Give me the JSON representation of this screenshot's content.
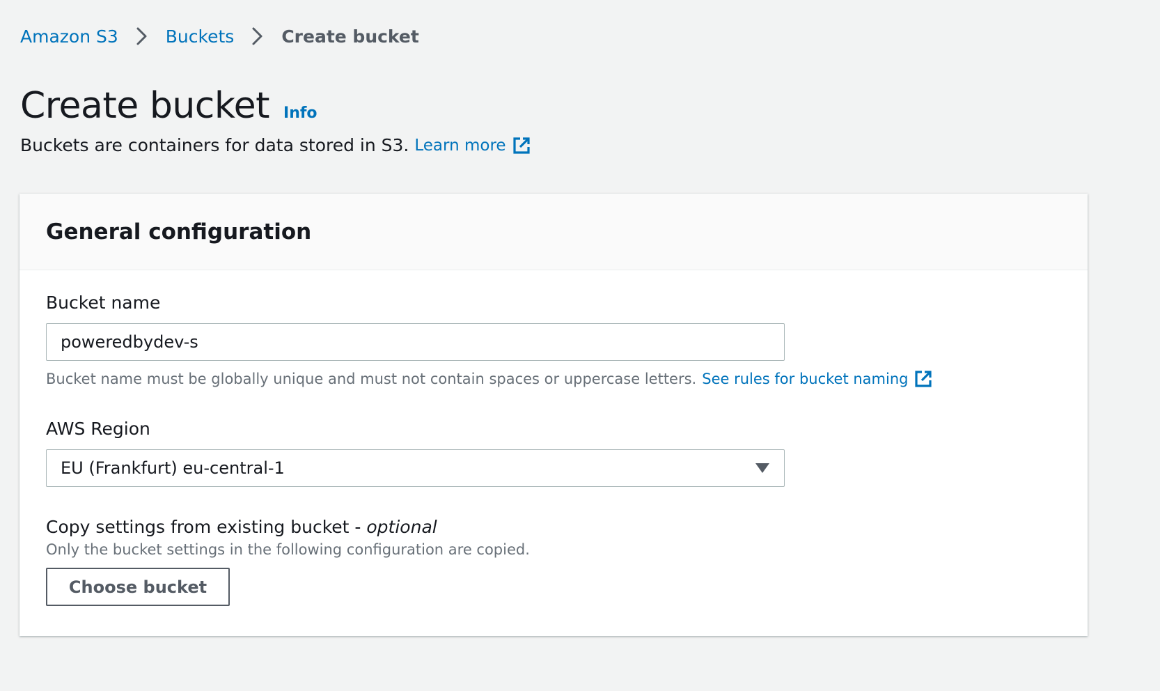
{
  "breadcrumb": {
    "items": [
      {
        "label": "Amazon S3"
      },
      {
        "label": "Buckets"
      },
      {
        "label": "Create bucket"
      }
    ]
  },
  "header": {
    "title": "Create bucket",
    "info_label": "Info",
    "subtitle": "Buckets are containers for data stored in S3.",
    "learn_more": "Learn more"
  },
  "general_configuration": {
    "title": "General configuration",
    "bucket_name": {
      "label": "Bucket name",
      "value": "poweredbydev-s",
      "hint": "Bucket name must be globally unique and must not contain spaces or uppercase letters.",
      "rules_link": "See rules for bucket naming"
    },
    "region": {
      "label": "AWS Region",
      "selected": "EU (Frankfurt) eu-central-1"
    },
    "copy_settings": {
      "label": "Copy settings from existing bucket - ",
      "optional": "optional",
      "description": "Only the bucket settings in the following configuration are copied.",
      "button_label": "Choose bucket"
    }
  },
  "colors": {
    "link": "#0073bb",
    "text": "#16191f",
    "muted": "#687078",
    "background": "#f2f3f3",
    "panel_header": "#fafafa"
  },
  "icons": {
    "breadcrumb_separator": "chevron-right-icon",
    "external_link": "external-link-icon",
    "select_caret": "caret-down-icon"
  }
}
